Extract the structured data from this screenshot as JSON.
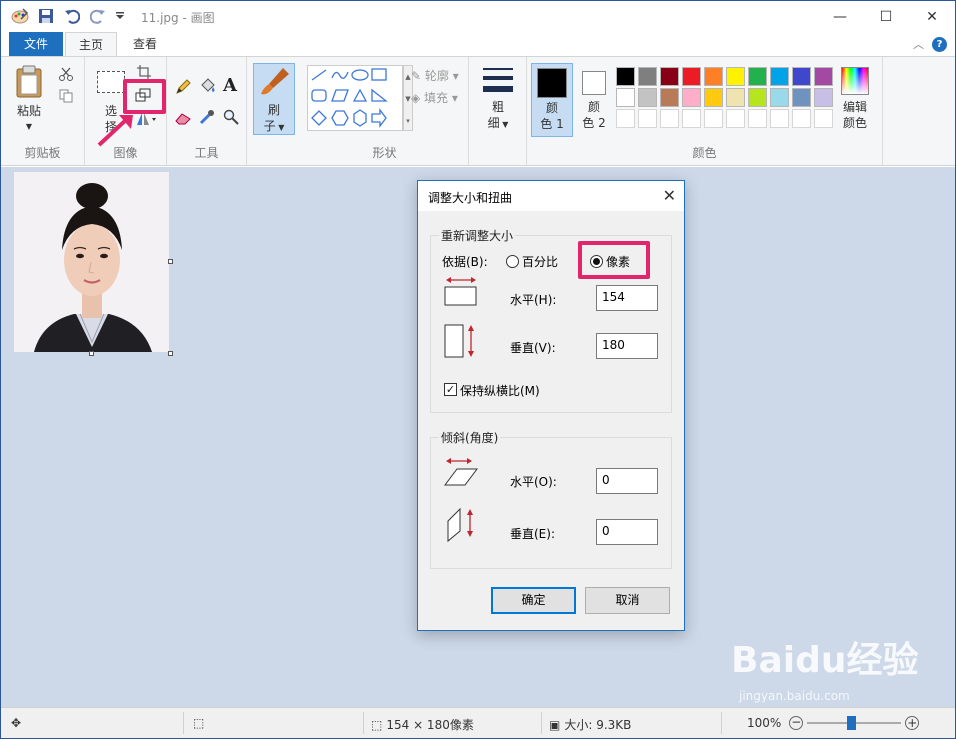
{
  "title": {
    "text": "11.jpg - 画图",
    "minimize": "—",
    "maximize": "☐",
    "close": "✕"
  },
  "tabs": [
    "文件",
    "主页",
    "查看"
  ],
  "ribbon": {
    "clipboard": {
      "paste": "粘贴",
      "group": "剪贴板"
    },
    "image": {
      "select_1": "选",
      "select_2": "择",
      "group": "图像"
    },
    "tools": {
      "text_tool": "A",
      "group": "工具"
    },
    "brush": {
      "label_1": "刷",
      "label_2": "子"
    },
    "shapes": {
      "outline": "轮廓",
      "fill": "填充",
      "group": "形状"
    },
    "size": {
      "label_1": "粗",
      "label_2": "细"
    },
    "color1": {
      "label_1": "颜",
      "label_2": "色 1"
    },
    "color2": {
      "label_1": "颜",
      "label_2": "色 2"
    },
    "colors": {
      "group": "颜色",
      "edit_1": "编辑",
      "edit_2": "颜色",
      "row1": [
        "#000000",
        "#7f7f7f",
        "#880015",
        "#ed1c24",
        "#ff7f27",
        "#fff200",
        "#22b14c",
        "#00a2e8",
        "#3f48cc",
        "#a349a4"
      ],
      "row2": [
        "#ffffff",
        "#c3c3c3",
        "#b97a57",
        "#ffaec9",
        "#ffc90e",
        "#efe4b0",
        "#b5e61d",
        "#99d9ea",
        "#7092be",
        "#c8bfe7"
      ]
    }
  },
  "dialog": {
    "title": "调整大小和扭曲",
    "resize_legend": "重新调整大小",
    "by_label": "依据(B):",
    "percent": "百分比",
    "pixels": "像素",
    "horizontal": "水平(H):",
    "horizontal_value": "154",
    "vertical": "垂直(V):",
    "vertical_value": "180",
    "keep_ratio": "保持纵横比(M)",
    "skew_legend": "倾斜(角度)",
    "skew_horizontal": "水平(O):",
    "skew_horizontal_value": "0",
    "skew_vertical": "垂直(E):",
    "skew_vertical_value": "0",
    "ok": "确定",
    "cancel": "取消"
  },
  "status": {
    "dimensions": "154 × 180像素",
    "size": "大小: 9.3KB",
    "zoom": "100%"
  },
  "watermark": {
    "text": "Baidu经验",
    "url": "jingyan.baidu.com"
  },
  "colors": {
    "accent": "#1f6fbf",
    "highlight": "#e2266c"
  }
}
